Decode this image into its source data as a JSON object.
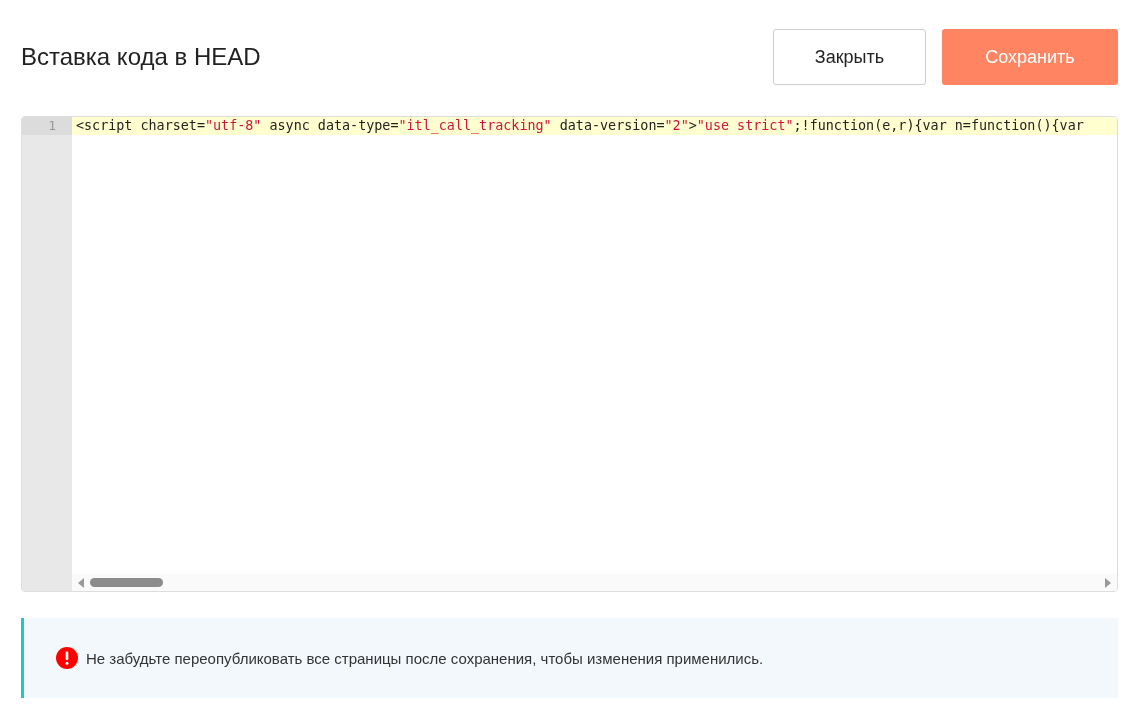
{
  "header": {
    "title": "Вставка кода в HEAD",
    "buttons": [
      {
        "label": "Закрыть",
        "kind": "secondary"
      },
      {
        "label": "Сохранить",
        "kind": "primary"
      }
    ]
  },
  "editor": {
    "lines": [
      {
        "number": "1",
        "active": true,
        "tokens": [
          {
            "kind": "plain",
            "text": "<script charset="
          },
          {
            "kind": "string",
            "text": "\"utf-8\""
          },
          {
            "kind": "plain",
            "text": " async data-type="
          },
          {
            "kind": "string",
            "text": "\"itl_call_tracking\""
          },
          {
            "kind": "plain",
            "text": " data-version="
          },
          {
            "kind": "string",
            "text": "\"2\""
          },
          {
            "kind": "plain",
            "text": ">"
          },
          {
            "kind": "string",
            "text": "\"use strict\""
          },
          {
            "kind": "plain",
            "text": ";!function(e,r){var n=function(){var"
          }
        ]
      }
    ]
  },
  "notice": {
    "text": "Не забудьте переопубликовать все страницы после сохранения, чтобы изменения применились."
  }
}
